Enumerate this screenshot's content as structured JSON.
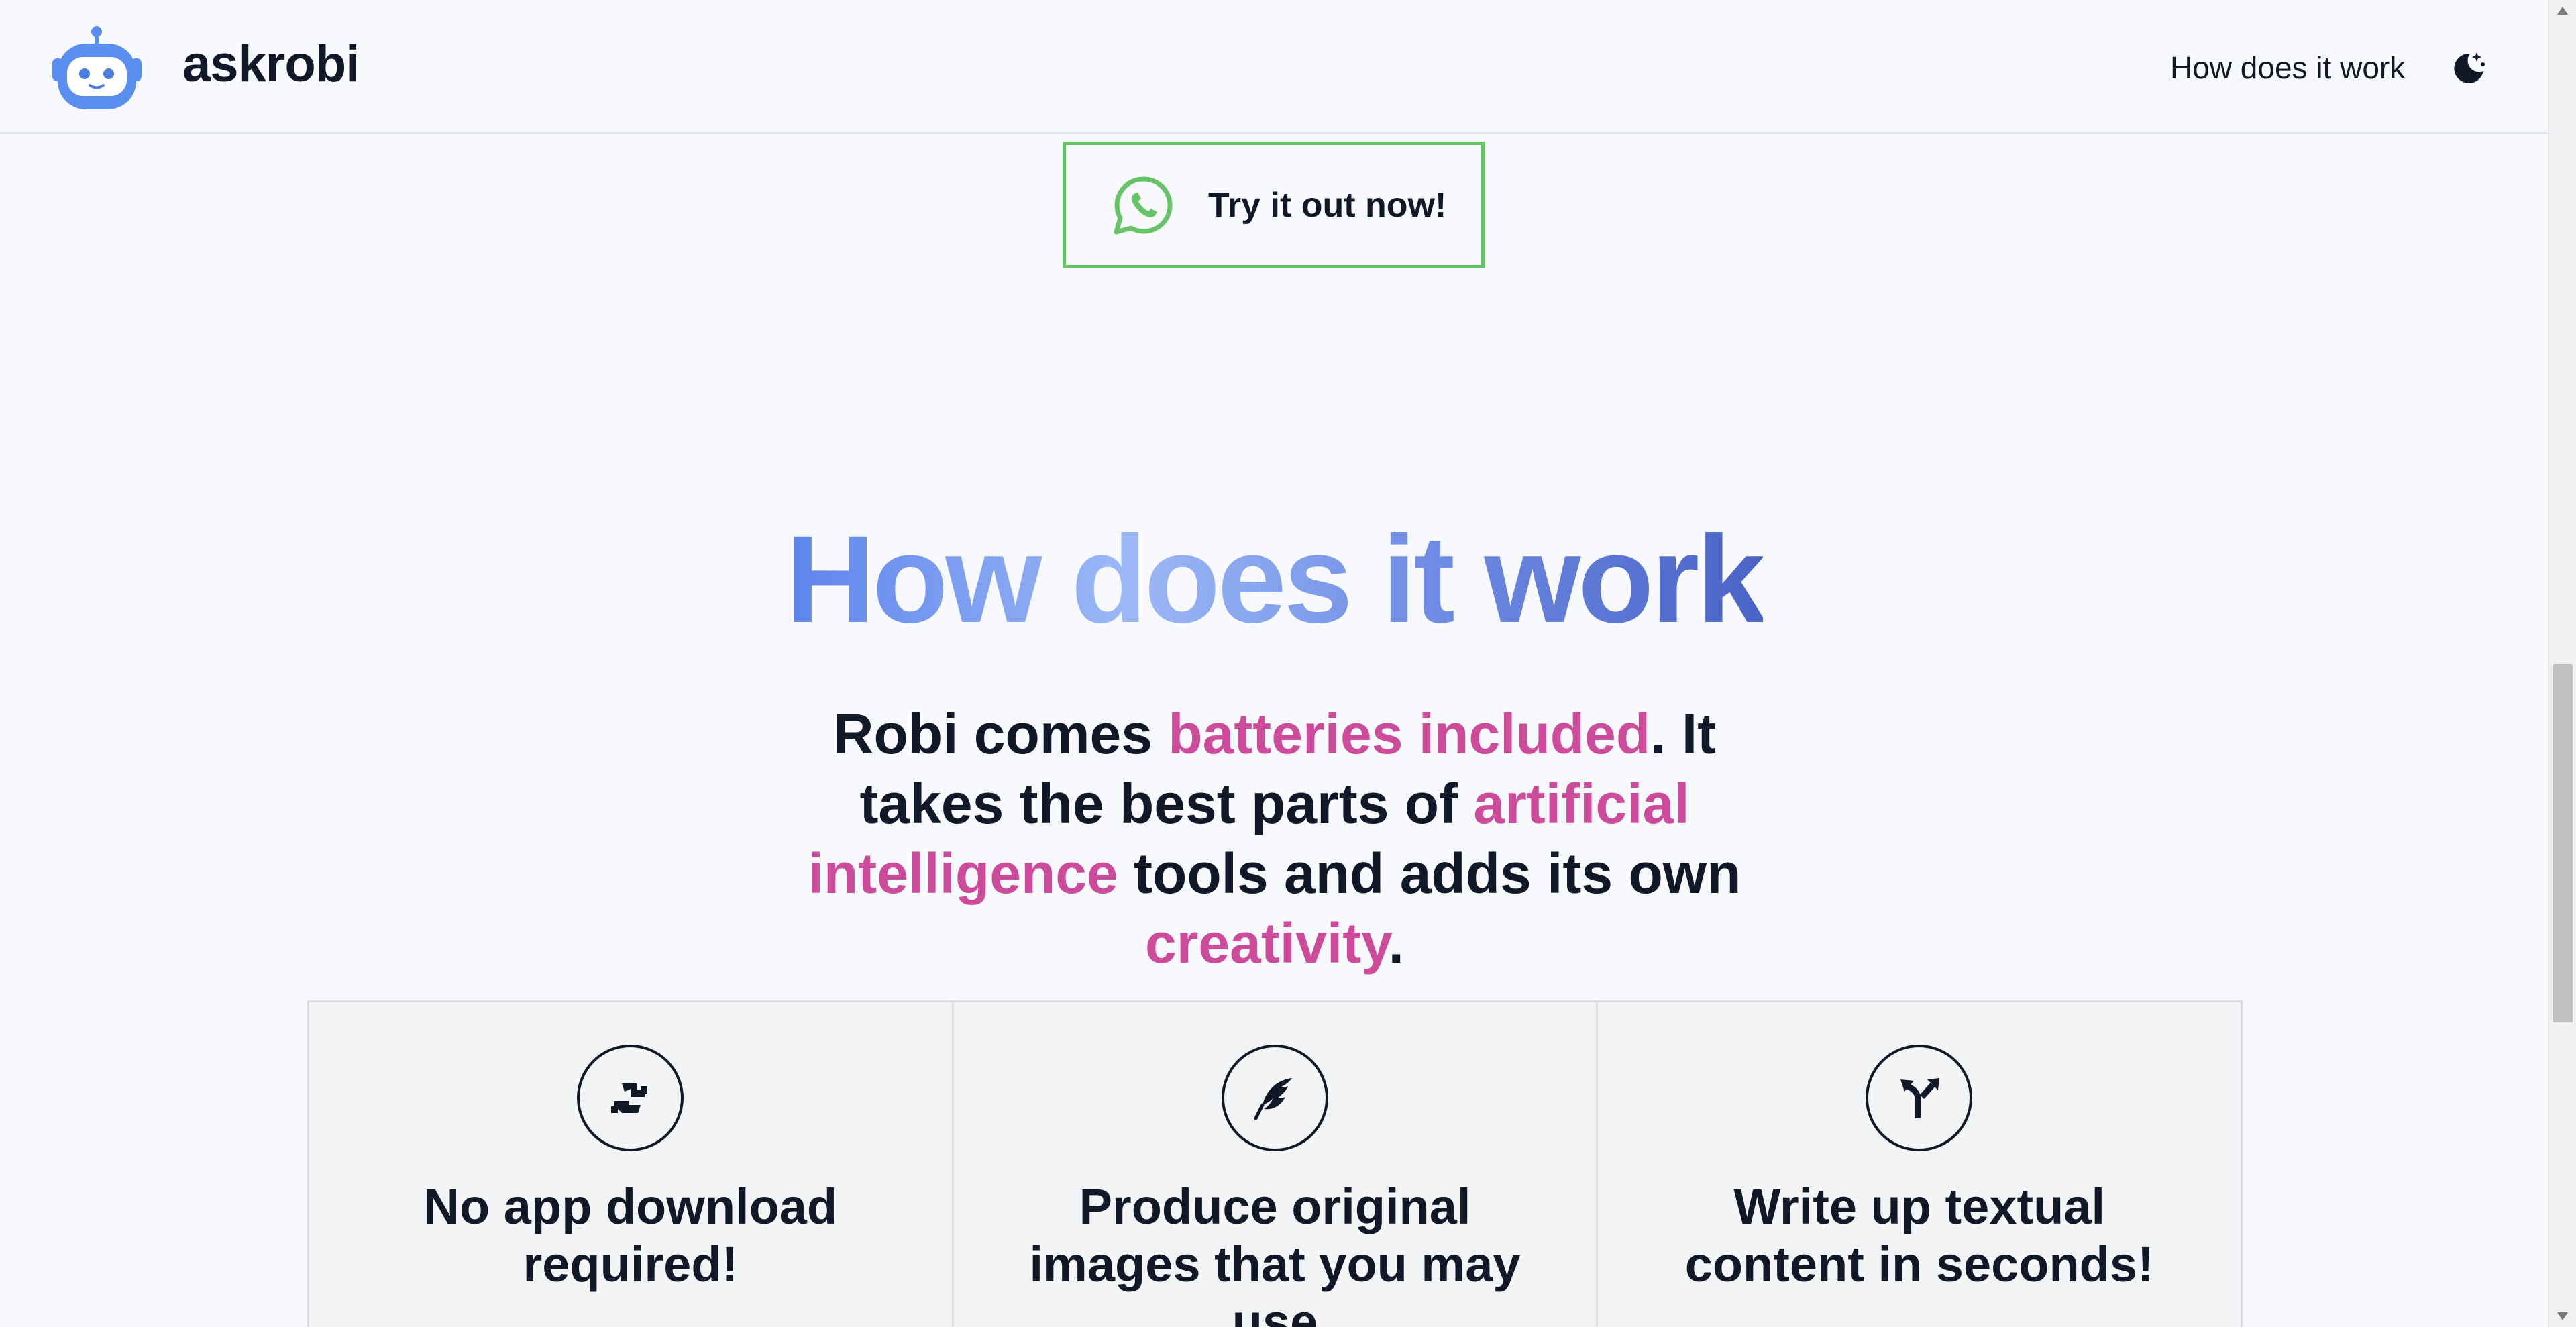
{
  "header": {
    "brand": "askrobi",
    "nav_link": "How does it work",
    "logo_icon": "robot-icon",
    "theme_icon": "moon-stars-icon"
  },
  "cta": {
    "label": "Try it out now!",
    "icon": "whatsapp-icon",
    "border_color": "#66c466"
  },
  "section": {
    "title": "How does it work"
  },
  "intro": {
    "p1": "Robi comes ",
    "h1": "batteries included",
    "p2": ". It takes the best parts of ",
    "h2": "artificial intelligence",
    "p3": " tools and adds its own ",
    "h3": "creativity",
    "p4": ".",
    "highlight_color": "#cc4b9b"
  },
  "features": [
    {
      "icon": "handshake-icon",
      "title": "No app download required!"
    },
    {
      "icon": "feather-icon",
      "title": "Produce original images that you may use"
    },
    {
      "icon": "split-arrow-icon",
      "title": "Write up textual content in seconds!"
    }
  ],
  "colors": {
    "accent_blue": "#5d84ec",
    "text": "#111827",
    "background": "#f8f9fc"
  }
}
